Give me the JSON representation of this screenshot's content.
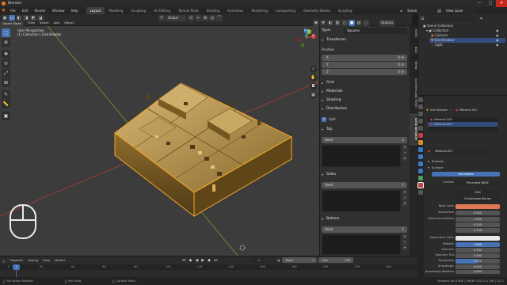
{
  "app": {
    "title": "Blender"
  },
  "window_controls": {
    "minimize": "—",
    "maximize": "□",
    "close": "✕"
  },
  "menus": [
    "File",
    "Edit",
    "Render",
    "Window",
    "Help"
  ],
  "workspaces": [
    "Layout",
    "Modeling",
    "Sculpting",
    "UV Editing",
    "Texture Paint",
    "Shading",
    "Animation",
    "Rendering",
    "Compositing",
    "Geometry Nodes",
    "Scripting"
  ],
  "active_workspace": "Layout",
  "scene": {
    "label": "Scene",
    "view_layer": "View Layer"
  },
  "viewport_header": {
    "mode": "Object Mode",
    "menus": [
      "View",
      "Select",
      "Add",
      "Object"
    ],
    "transform": "Global",
    "options": "Options"
  },
  "viewport": {
    "info_line1": "User Perspective",
    "info_line2": "(1) Collection | Grid Breaker",
    "gizmo": {
      "x": "X",
      "y": "Y",
      "z": "Z"
    }
  },
  "npanel": {
    "tabs": [
      "Item",
      "Tool",
      "View",
      "Screencast Keys",
      "Grid Breaker"
    ],
    "active_tab": "Grid Breaker",
    "type_label": "Type:",
    "type_value": "Squares",
    "transforms": "Transforms",
    "position": "Position:",
    "x_label": "X",
    "x_value": "0 m",
    "y_label": "Y",
    "y_value": "0 m",
    "z_label": "Z",
    "z_value": "0 m",
    "grid": "Grid",
    "materials": "Materials",
    "shading": "Shading",
    "distribution": "Distribution",
    "split": "Split",
    "top": "Top",
    "sides": "Sides",
    "bottom": "Bottom",
    "seed_label": "Seed",
    "seed_top": "1",
    "seed_sides": "1",
    "seed_bottom": "1"
  },
  "outliner": {
    "scene_collection": "Scene Collection",
    "collection": "Collection",
    "items": [
      "Camera",
      "Grid Breaker",
      "Light"
    ]
  },
  "properties": {
    "object_name": "Grid Breaker",
    "material_name": "Material.007",
    "slots": [
      "Material.008",
      "Material.007"
    ],
    "material_field": "Material.007",
    "preview": "Preview",
    "surface": "Surface",
    "use_nodes": "Use Nodes",
    "surface_label": "Surface",
    "surface_value": "Principled BSDF",
    "distribution": "GGX",
    "subsurface_method": "Christensen-Burley",
    "rows": [
      {
        "label": "Base Color",
        "value": ""
      },
      {
        "label": "Subsurface",
        "value": "0.000"
      },
      {
        "label": "Subsurface Radius",
        "value": "1.000"
      },
      {
        "label": "",
        "value": "0.200"
      },
      {
        "label": "",
        "value": "0.100"
      },
      {
        "label": "Subsurface Color",
        "value": ""
      },
      {
        "label": "Metallic",
        "value": "1.000"
      },
      {
        "label": "Specular",
        "value": "0.132"
      },
      {
        "label": "Specular Tint",
        "value": "0.000"
      },
      {
        "label": "Roughness",
        "value": "0.500"
      },
      {
        "label": "Anisotropic",
        "value": "0.000"
      },
      {
        "label": "Anisotropic Rotation",
        "value": "0.000"
      }
    ],
    "base_color_hex": "#e07a55",
    "metallic_fraction": 1.0,
    "roughness_fraction": 0.5
  },
  "timeline": {
    "menus": [
      "Playback",
      "Keying",
      "View",
      "Marker"
    ],
    "current_frame": "1",
    "start_label": "Start",
    "start_value": "1",
    "end_label": "End",
    "end_value": "250",
    "ticks": [
      "0",
      "20",
      "40",
      "60",
      "80",
      "100",
      "120",
      "140",
      "160",
      "180",
      "200",
      "220",
      "240"
    ]
  },
  "statusbar": {
    "left1": "Set Active Modifier",
    "left2": "Pan View",
    "left3": "Context Menu",
    "right": "Memory: 64.8 MiB | VRAM: 0.8/11.0 GiB | 3.0.1"
  },
  "colors": {
    "accent": "#4772b3",
    "selected_outline": "#f5a623",
    "block_gold": "#b8924a",
    "x_axis": "#d0413a",
    "y_axis": "#8cba3a",
    "z_axis": "#2a8cd8"
  }
}
